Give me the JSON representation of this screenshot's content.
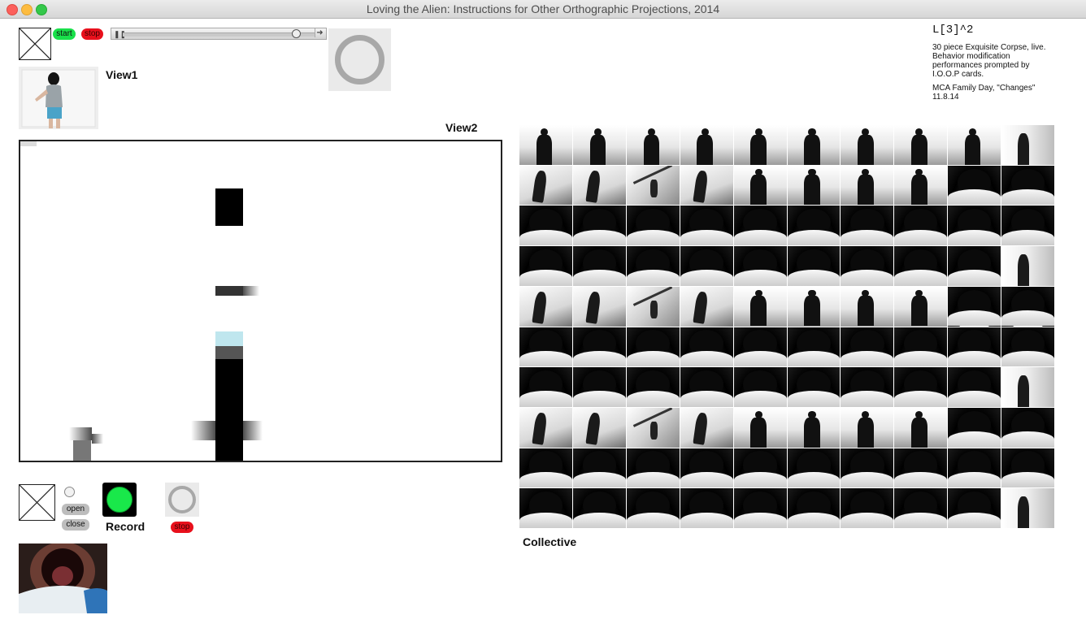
{
  "window": {
    "title": "Loving the Alien: Instructions for Other Orthographic Projections, 2014"
  },
  "top_controls": {
    "start_label": "start",
    "stop_label": "stop"
  },
  "views": {
    "view1_label": "View1",
    "view2_label": "View2",
    "collective_label": "Collective"
  },
  "info": {
    "heading": "L[3]^2",
    "description": "30 piece Exquisite Corpse, live. Behavior modification performances prompted by I.O.O.P cards.",
    "event": "MCA Family Day, \"Changes\"",
    "date": "11.8.14"
  },
  "bottom_controls": {
    "open_label": "open",
    "close_label": "close",
    "record_label": "Record",
    "stop_label": "stop"
  },
  "colors": {
    "start": "#19e04a",
    "stop": "#e8101c",
    "record": "#19e84a"
  },
  "collective_grid": {
    "rows": 10,
    "cols": 10,
    "cells": [
      "sil",
      "sil",
      "sil",
      "sil",
      "sil",
      "sil",
      "sil",
      "sil",
      "sil",
      "edge",
      "shadow",
      "shadow",
      "floor",
      "shadow",
      "sil",
      "sil",
      "sil",
      "sil",
      "mouth",
      "mouth",
      "mouth",
      "mouth",
      "mouth",
      "mouth",
      "mouth",
      "mouth",
      "mouth",
      "mouth",
      "mouth",
      "mouth",
      "mouth",
      "mouth",
      "mouth",
      "mouth",
      "mouth",
      "mouth",
      "mouth",
      "mouth",
      "mouth",
      "edge",
      "shadow",
      "shadow",
      "floor",
      "shadow",
      "sil",
      "sil",
      "sil",
      "sil",
      "mouth",
      "mouth",
      "mouth",
      "mouth",
      "mouth",
      "mouth",
      "mouth",
      "mouth",
      "mouth",
      "mouth",
      "mouth",
      "mouth",
      "mouth",
      "mouth",
      "mouth",
      "mouth",
      "mouth",
      "mouth",
      "mouth",
      "mouth",
      "mouth",
      "edge",
      "shadow",
      "shadow",
      "floor",
      "shadow",
      "sil",
      "sil",
      "sil",
      "sil",
      "mouth",
      "mouth",
      "mouth",
      "mouth",
      "mouth",
      "mouth",
      "mouth",
      "mouth",
      "mouth",
      "mouth",
      "mouth",
      "mouth",
      "mouth",
      "mouth",
      "mouth",
      "mouth",
      "mouth",
      "mouth",
      "mouth",
      "mouth",
      "mouth",
      "edge"
    ]
  }
}
